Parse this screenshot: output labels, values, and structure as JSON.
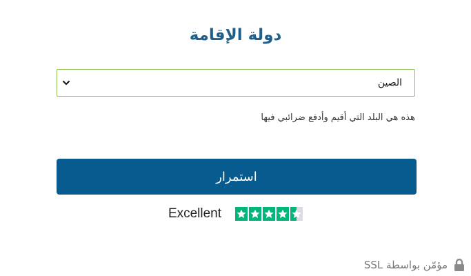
{
  "form": {
    "title": "دولة الإقامة",
    "country_select": {
      "selected_value": "الصين"
    },
    "hint": "هذه هي البلد التي أقيم وأدفع ضرائبي فيها",
    "continue_label": "استمرار"
  },
  "rating": {
    "label": "Excellent",
    "stars_total": 5,
    "stars_filled": 4.5,
    "star_color": "#00b67a",
    "empty_color": "#dcdce6"
  },
  "footer": {
    "secure_text": "مؤمّن بواسطة SSL",
    "icon": "lock-icon"
  },
  "colors": {
    "title": "#1f5f8b",
    "button": "#075b8e",
    "select_border": "#8cc152"
  }
}
